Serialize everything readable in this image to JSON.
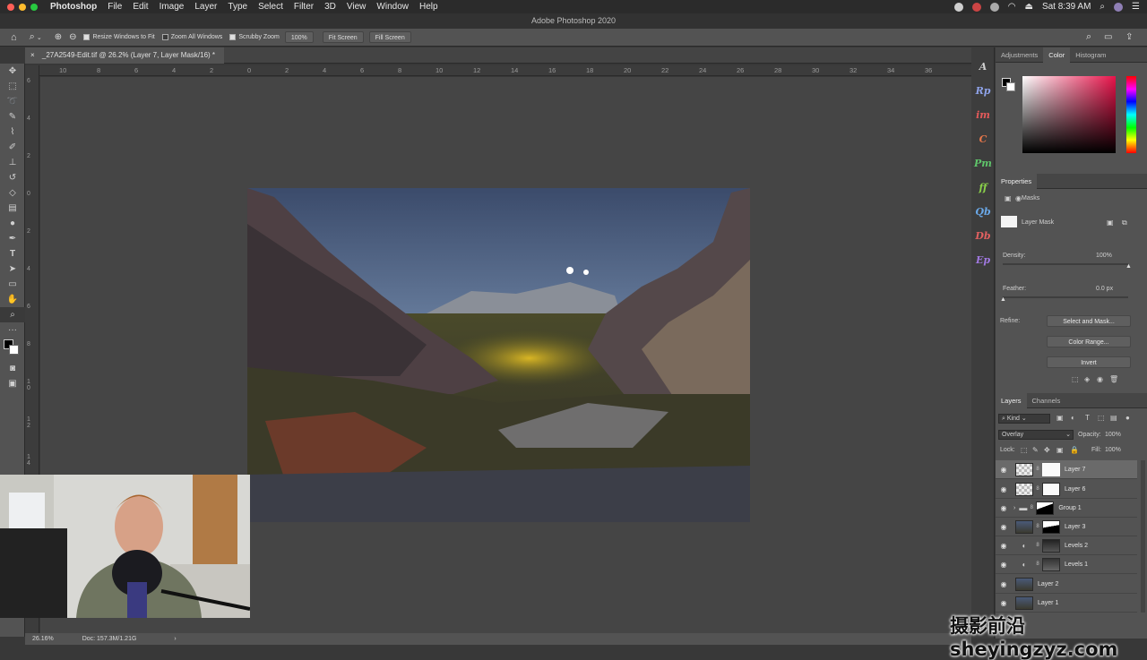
{
  "menubar": {
    "items": [
      "Photoshop",
      "File",
      "Edit",
      "Image",
      "Layer",
      "Type",
      "Select",
      "Filter",
      "3D",
      "View",
      "Window",
      "Help"
    ],
    "clock": "Sat 8:39 AM"
  },
  "window_title": "Adobe Photoshop 2020",
  "options": {
    "resize_windows": "Resize Windows to Fit",
    "zoom_all": "Zoom All Windows",
    "scrubby_zoom": "Scrubby Zoom",
    "zoom_value": "100%",
    "fit_screen": "Fit Screen",
    "fill_screen": "Fill Screen"
  },
  "document": {
    "tab_title": "_27A2549-Edit.tif @ 26.2% (Layer 7, Layer Mask/16) *"
  },
  "ruler": {
    "h_ticks": [
      "10",
      "8",
      "6",
      "4",
      "2",
      "0",
      "2",
      "4",
      "6",
      "8",
      "10",
      "12",
      "14",
      "16",
      "18",
      "20",
      "22",
      "24",
      "26",
      "28",
      "30",
      "32",
      "34",
      "36"
    ],
    "v_ticks": [
      "6",
      "4",
      "2",
      "0",
      "2",
      "4",
      "6",
      "8",
      "1 0",
      "1 2",
      "1 4"
    ]
  },
  "plugins": [
    "A",
    "Rp",
    "im",
    "C",
    "Pm",
    "ff",
    "Qb",
    "Db",
    "Ep"
  ],
  "color_panel": {
    "tabs": [
      "Adjustments",
      "Color",
      "Histogram"
    ],
    "active_tab": "Color",
    "hue_color": "#e8134a"
  },
  "properties": {
    "title": "Properties",
    "masks_label": "Masks",
    "layer_mask_label": "Layer Mask",
    "density_label": "Density:",
    "density_value": "100%",
    "density_level": 1.0,
    "feather_label": "Feather:",
    "feather_value": "0.0 px",
    "feather_level": 0.0,
    "refine_label": "Refine:",
    "select_and_mask": "Select and Mask...",
    "color_range": "Color Range...",
    "invert": "Invert"
  },
  "layers_panel": {
    "tabs": [
      "Layers",
      "Channels"
    ],
    "kind_label": "Kind",
    "blend_mode": "Overlay",
    "opacity_label": "Opacity:",
    "opacity_value": "100%",
    "lock_label": "Lock:",
    "fill_label": "Fill:",
    "fill_value": "100%",
    "layers": [
      {
        "name": "Layer 7"
      },
      {
        "name": "Layer 6"
      },
      {
        "name": "Group 1"
      },
      {
        "name": "Layer 3"
      },
      {
        "name": "Levels 2"
      },
      {
        "name": "Levels 1"
      },
      {
        "name": "Layer 2"
      },
      {
        "name": "Layer 1"
      }
    ]
  },
  "statusbar": {
    "zoom": "26.16%",
    "doc_info": "Doc: 157.3M/1.21G"
  },
  "watermark": "摄影前沿sheyingzyz.com"
}
